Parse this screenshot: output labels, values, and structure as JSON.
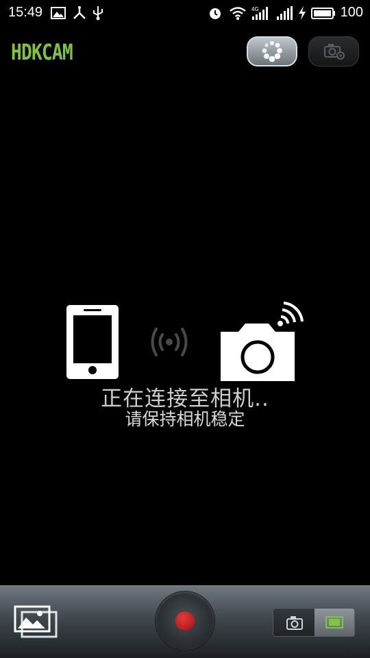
{
  "status_bar": {
    "time": "15:49",
    "battery_level": "100",
    "icons": [
      "gallery-notification-icon",
      "usb-debug-icon",
      "usb-icon",
      "alarm-icon",
      "wifi-icon",
      "mobile-data-4g-icon",
      "cell-signal-icon",
      "charging-icon",
      "battery-icon"
    ]
  },
  "app_bar": {
    "title": "HDKCAM",
    "title_color": "#7ec43c",
    "refresh_icon": "loading-spinner-icon",
    "settings_icon": "camera-gear-icon"
  },
  "connection": {
    "phone_icon": "smartphone-icon",
    "signal_icon": "wireless-signal-icon",
    "camera_icon": "camera-wifi-icon",
    "status_text": "正在连接至相机..",
    "hint_text": "请保持相机稳定"
  },
  "bottom_bar": {
    "gallery_icon": "gallery-icon",
    "record_icon": "record-icon",
    "record_color": "#d12626",
    "mode_options": [
      "camera-icon",
      "video-mode-icon"
    ],
    "selected_mode": "video-mode-icon",
    "accent_color": "#7ec43c"
  }
}
